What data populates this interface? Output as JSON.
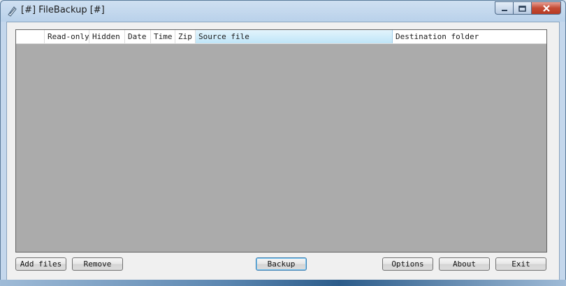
{
  "window": {
    "title": "[#] FileBackup [#]"
  },
  "titlebar_buttons": {
    "minimize": "minimize-icon",
    "maximize": "maximize-icon",
    "close": "close-icon"
  },
  "table": {
    "columns": [
      "",
      "Read-only",
      "Hidden",
      "Date",
      "Time",
      "Zip",
      "Source file",
      "Destination folder"
    ],
    "rows": []
  },
  "buttons": {
    "add_files": "Add files",
    "remove": "Remove",
    "backup": "Backup",
    "options": "Options",
    "about": "About",
    "exit": "Exit"
  }
}
